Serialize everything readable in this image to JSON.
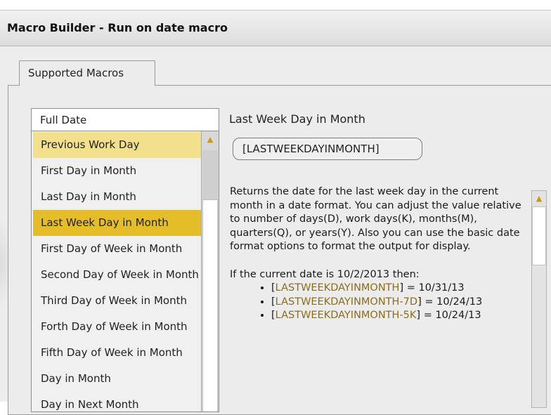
{
  "window": {
    "title": "Macro Builder - Run on date macro"
  },
  "tabs": [
    {
      "label": "Supported Macros"
    }
  ],
  "list": {
    "header": "Full Date",
    "items": [
      {
        "label": "Previous Work Day"
      },
      {
        "label": "First Day in Month"
      },
      {
        "label": "Last Day in Month"
      },
      {
        "label": "Last Week Day in Month"
      },
      {
        "label": "First Day of Week in Month"
      },
      {
        "label": "Second Day of Week in Month"
      },
      {
        "label": "Third Day of Week in Month"
      },
      {
        "label": "Forth Day of Week in Month"
      },
      {
        "label": "Fifth Day of Week in Month"
      },
      {
        "label": "Day in Month"
      },
      {
        "label": "Day in Next Month"
      }
    ],
    "hover_index": 0,
    "selected_index": 3
  },
  "detail": {
    "title": "Last Week Day in Month",
    "code": "[LASTWEEKDAYINMONTH]",
    "description": "Returns the date for the last week day in the current month in a date format. You can adjust the value relative to number of days(D), work days(K), months(M), quarters(Q), or years(Y). Also you can use the basic date format options to format the output for display.",
    "example_intro": "If the current date is 10/2/2013 then:",
    "examples": [
      {
        "open": "[",
        "token": "LASTWEEKDAYINMONTH",
        "modifier": "",
        "close": "] = 10/31/13"
      },
      {
        "open": "[",
        "token": "LASTWEEKDAYINMONTH",
        "modifier": "-7D",
        "close": "] = 10/24/13"
      },
      {
        "open": "[",
        "token": "LASTWEEKDAYINMONTH",
        "modifier": "-5K",
        "close": "] = 10/24/13"
      }
    ]
  },
  "icons": {
    "scroll_up": "triangle-up-icon"
  },
  "colors": {
    "hover": "#f3e08c",
    "selected": "#e4bd28",
    "token": "#8a6d1d"
  }
}
